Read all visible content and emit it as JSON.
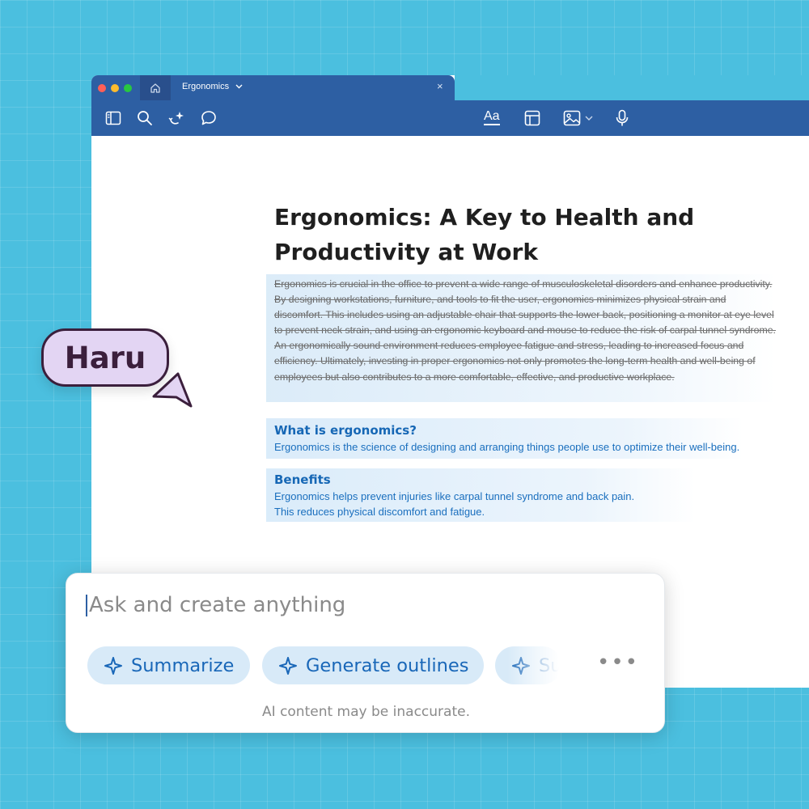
{
  "window": {
    "tab_title": "Ergonomics",
    "tab_close": "×",
    "toolbar": {
      "left_icons": [
        "sidebar-icon",
        "search-icon",
        "ai-sparkle-icon",
        "comment-icon"
      ],
      "right_icons": [
        "text-style-icon",
        "table-icon",
        "image-icon",
        "microphone-icon"
      ],
      "text_style_label": "Aa"
    }
  },
  "document": {
    "title": "Ergonomics: A Key to Health and Productivity at Work",
    "paragraph": "Ergonomics is crucial in the office to prevent a wide range of musculoskeletal disorders and enhance productivity. By designing workstations, furniture, and tools to fit the user, ergonomics minimizes physical strain and discomfort. This includes using an adjustable chair that supports the lower back, positioning a monitor at eye level to prevent neck strain, and using an ergonomic keyboard and mouse to reduce the risk of carpal tunnel syndrome. An ergonomically sound environment reduces employee fatigue and stress, leading to increased focus and efficiency. Ultimately, investing in proper ergonomics not only promotes the long-term health and well-being of employees but also contributes to a more comfortable, effective, and productive workplace.",
    "sections": [
      {
        "heading": "What is ergonomics?",
        "lines": [
          "Ergonomics is the science of designing and arranging things people use to optimize their well-being."
        ]
      },
      {
        "heading": "Benefits",
        "lines": [
          "Ergonomics helps prevent injuries like carpal tunnel syndrome and back pain.",
          "This reduces physical discomfort and fatigue."
        ]
      }
    ]
  },
  "collaborator": {
    "name": "Haru",
    "color": "#e3d5f3"
  },
  "ai_panel": {
    "placeholder": "Ask and create anything",
    "chips": [
      "Summarize",
      "Generate outlines",
      "Su"
    ],
    "more_label": "•••",
    "disclaimer": "AI content may be inaccurate."
  },
  "colors": {
    "background": "#4bbfdf",
    "toolbar": "#2d5fa3",
    "accent": "#1967b8"
  }
}
